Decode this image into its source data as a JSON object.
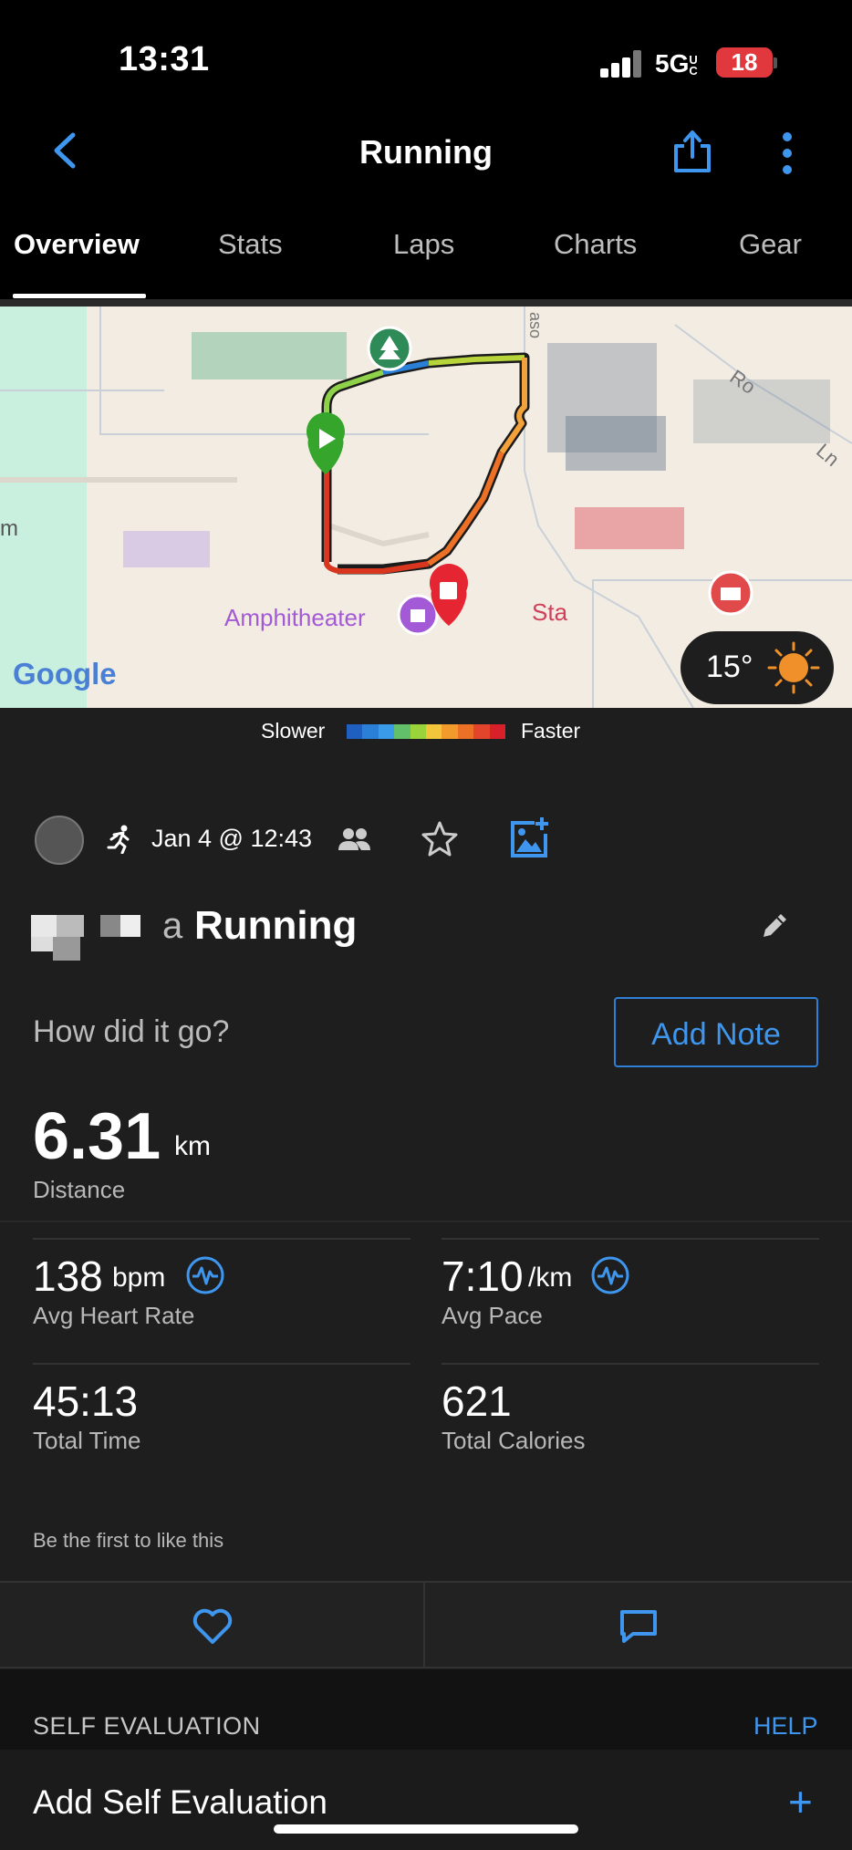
{
  "status_bar": {
    "time": "13:31",
    "network": "5G",
    "network_sub": "UC",
    "battery": "18"
  },
  "nav": {
    "title": "Running"
  },
  "tabs": [
    {
      "label": "Overview",
      "active": true
    },
    {
      "label": "Stats",
      "active": false
    },
    {
      "label": "Laps",
      "active": false
    },
    {
      "label": "Charts",
      "active": false
    },
    {
      "label": "Gear",
      "active": false
    }
  ],
  "map": {
    "labels": {
      "amphitheater": "Amphitheater",
      "partial_left": "m",
      "partial_state": "Sta",
      "partial_road1": "Ro",
      "partial_road2": "Ln",
      "partial_road3": "aso"
    },
    "google": "Google",
    "weather": {
      "temp": "15°",
      "icon": "sun-icon"
    }
  },
  "legend": {
    "slower": "Slower",
    "faster": "Faster",
    "colors": [
      "#1f5fbf",
      "#2a7fd6",
      "#3a9ce8",
      "#62c06a",
      "#9bd43a",
      "#f3c53a",
      "#f39a2c",
      "#ec7026",
      "#e3452c",
      "#d8202a"
    ]
  },
  "activity": {
    "date": "Jan 4 @ 12:43",
    "title_suffix": "a",
    "title": "Running",
    "question": "How did it go?",
    "add_note": "Add Note"
  },
  "stats": {
    "distance": {
      "value": "6.31",
      "unit": "km",
      "label": "Distance"
    },
    "heart_rate": {
      "value": "138",
      "unit": "bpm",
      "label": "Avg Heart Rate"
    },
    "pace": {
      "value": "7:10",
      "unit": "/km",
      "label": "Avg Pace"
    },
    "time": {
      "value": "45:13",
      "label": "Total Time"
    },
    "calories": {
      "value": "621",
      "label": "Total Calories"
    }
  },
  "social": {
    "like_text": "Be the first to like this"
  },
  "self_evaluation": {
    "section_title": "SELF EVALUATION",
    "help": "HELP",
    "add_label": "Add Self Evaluation",
    "plus": "+"
  },
  "colors": {
    "accent": "#3f96ee",
    "background": "#1e1e1e",
    "route_start": "#35a52b",
    "route_end": "#e52532"
  }
}
